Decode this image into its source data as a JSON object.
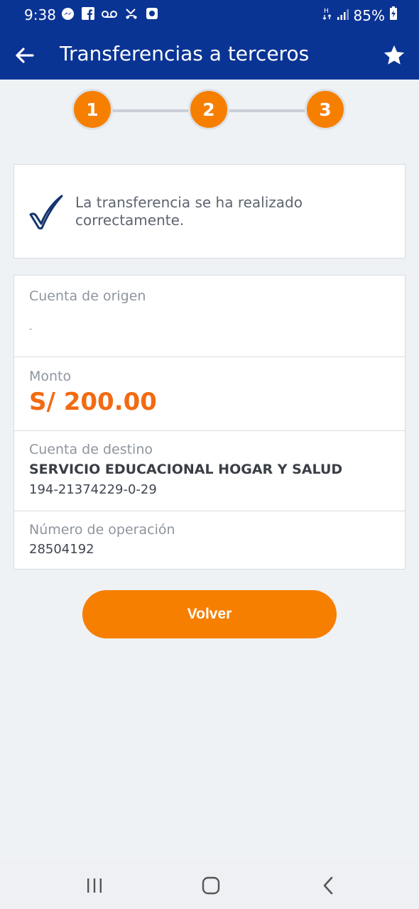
{
  "status_bar": {
    "time": "9:38",
    "battery": "85%",
    "left_icons": [
      "messenger-icon",
      "facebook-icon",
      "voicemail-icon",
      "missed-call-icon",
      "app-notification-icon"
    ],
    "right_icons": [
      "network-h-icon",
      "signal-icon",
      "battery-charging-icon"
    ]
  },
  "app_bar": {
    "title": "Transferencias a terceros",
    "back_icon": "arrow-left-icon",
    "favorite_icon": "star-icon",
    "background": "#0a3494"
  },
  "stepper": {
    "steps": [
      "1",
      "2",
      "3"
    ],
    "active_color": "#f77f00"
  },
  "success": {
    "icon": "checkmark-icon",
    "message": "La transferencia se ha realizado correctamente."
  },
  "details": {
    "origin": {
      "label": "Cuenta de origen",
      "value": "-"
    },
    "amount": {
      "label": "Monto",
      "value": "S/ 200.00"
    },
    "destination": {
      "label": "Cuenta de destino",
      "name": "SERVICIO EDUCACIONAL HOGAR Y SALUD",
      "account": "194-21374229-0-29"
    },
    "operation": {
      "label": "Número de operación",
      "value": "28504192"
    }
  },
  "actions": {
    "back_label": "Volver"
  },
  "nav_bar": {
    "icons": [
      "recent-apps-icon",
      "home-icon",
      "back-icon"
    ]
  },
  "colors": {
    "accent": "#f77f00",
    "amount": "#f26a12",
    "brand": "#0a3494"
  }
}
